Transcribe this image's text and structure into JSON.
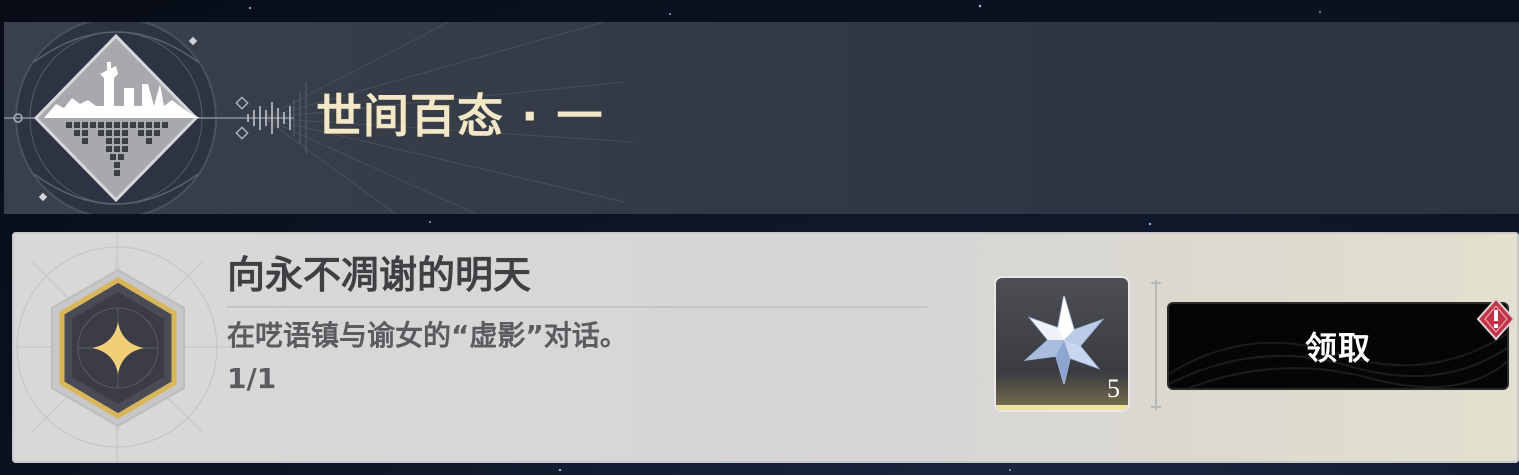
{
  "header": {
    "title": "世间百态 · 一",
    "emblem_icon": "city-skyline-icon"
  },
  "quest": {
    "icon": "sparkle-star-icon",
    "title": "向永不凋谢的明天",
    "description": "在呓语镇与谕女的“虚影”对话。",
    "progress": "1/1"
  },
  "reward": {
    "icon": "crystal-star-icon",
    "count": "5"
  },
  "claim_button": {
    "label": "领取",
    "alert_icon": "exclamation-badge-icon"
  },
  "colors": {
    "title_gold": "#f4e7c6",
    "button_black": "#050505",
    "alert_red": "#c23348",
    "hex_gold": "#d9b65a"
  }
}
